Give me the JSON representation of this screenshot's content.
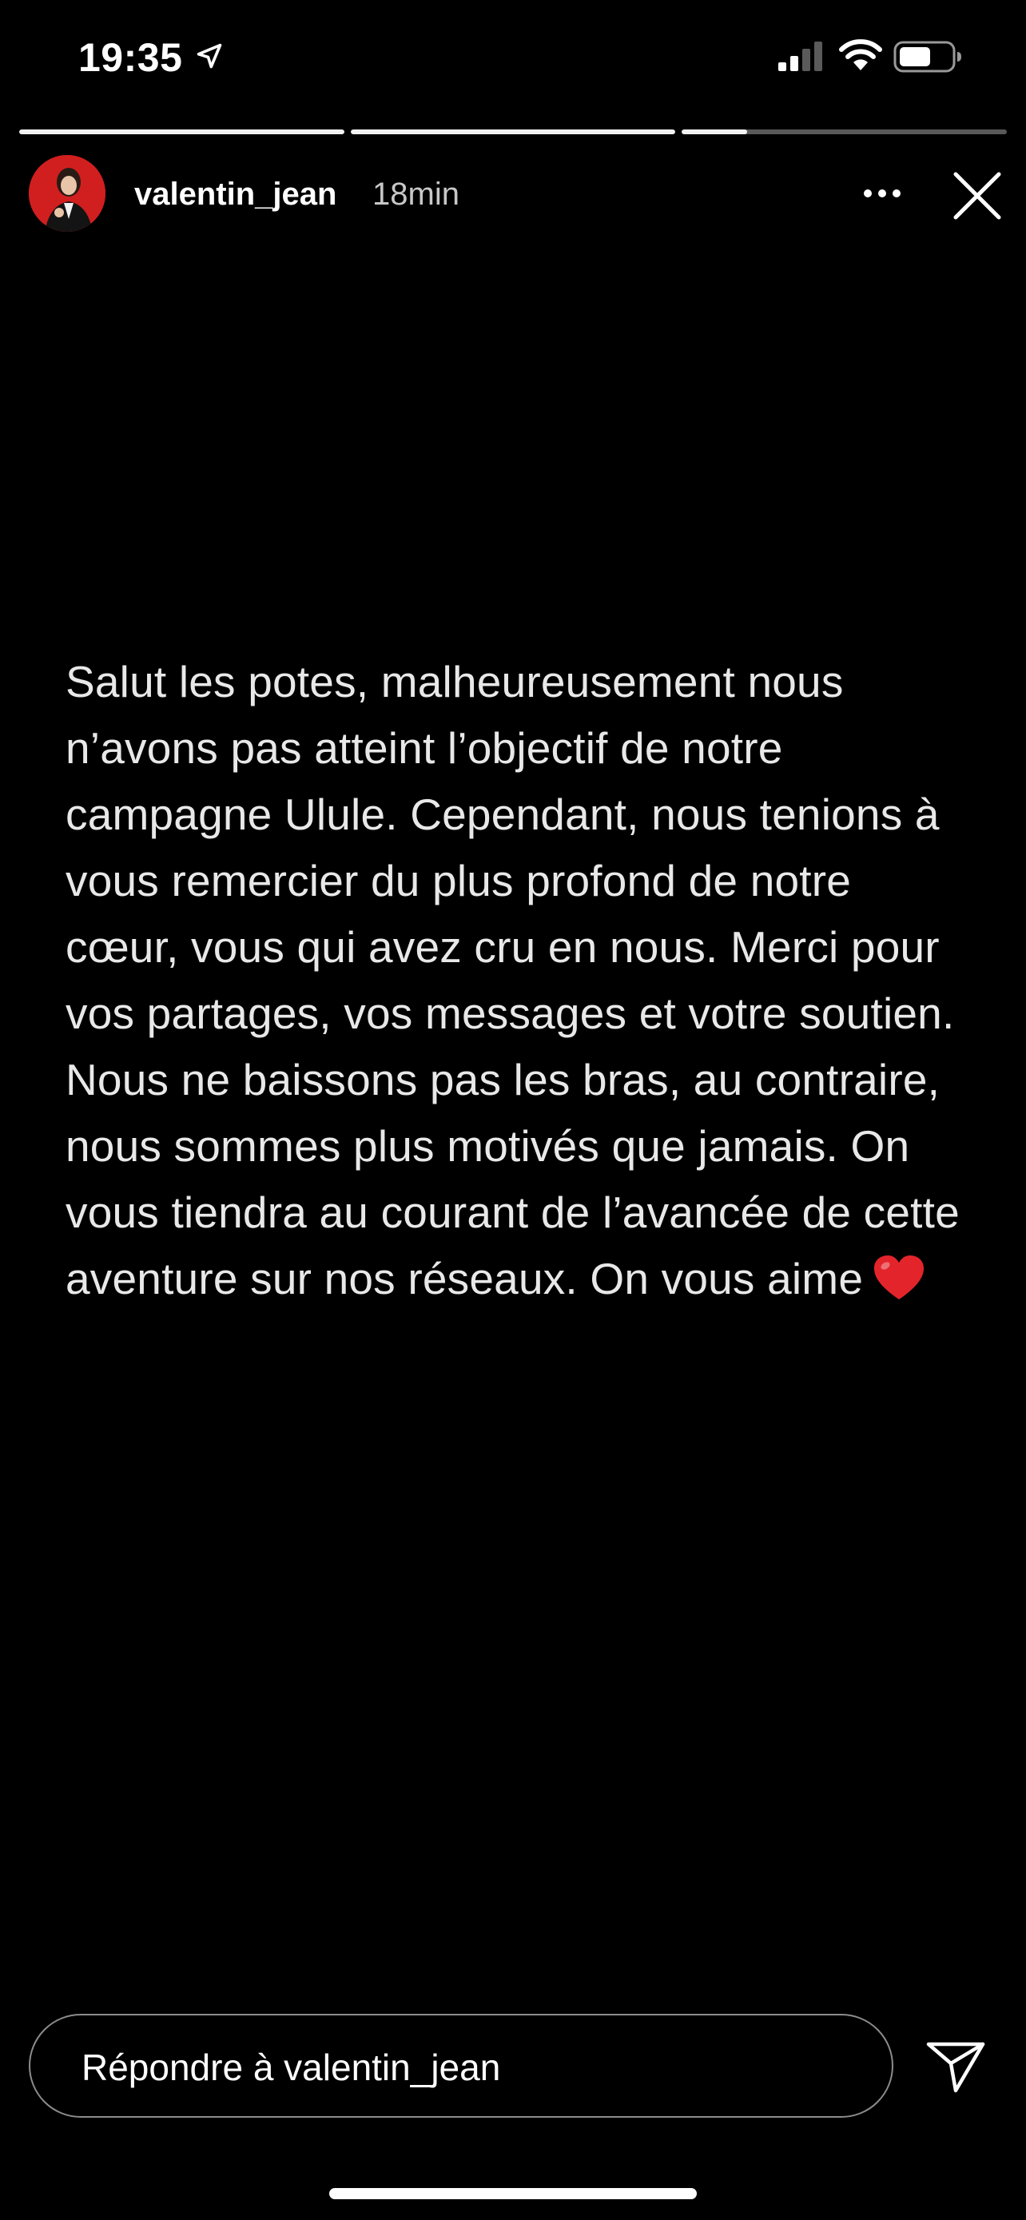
{
  "status_bar": {
    "time": "19:35"
  },
  "progress": {
    "segments": [
      1,
      1,
      0.2
    ]
  },
  "header": {
    "username": "valentin_jean",
    "timestamp": "18min"
  },
  "story": {
    "text": "Salut les potes, malheureusement nous n’avons pas atteint l’objectif de notre campagne Ulule. Cependant, nous tenions à vous remercier du plus profond de notre cœur, vous qui avez cru en nous. Merci pour vos partages, vos messages et votre soutien. Nous ne baissons pas les bras, au contraire, nous sommes plus motivés que jamais. On vous tiendra au courant de l’avancée de cette aventure sur nos réseaux. On vous aime"
  },
  "reply": {
    "placeholder": "Répondre à valentin_jean"
  },
  "colors": {
    "background": "#000000",
    "text": "#ffffff",
    "heart": "#e3242b",
    "avatar_bg": "#d11f1f"
  },
  "icons": {
    "location": "location-arrow-icon",
    "signal": "cellular-signal-icon",
    "wifi": "wifi-icon",
    "battery": "battery-icon",
    "more": "more-dots-icon",
    "close": "close-icon",
    "heart": "heart-emoji-icon",
    "send": "send-icon"
  }
}
